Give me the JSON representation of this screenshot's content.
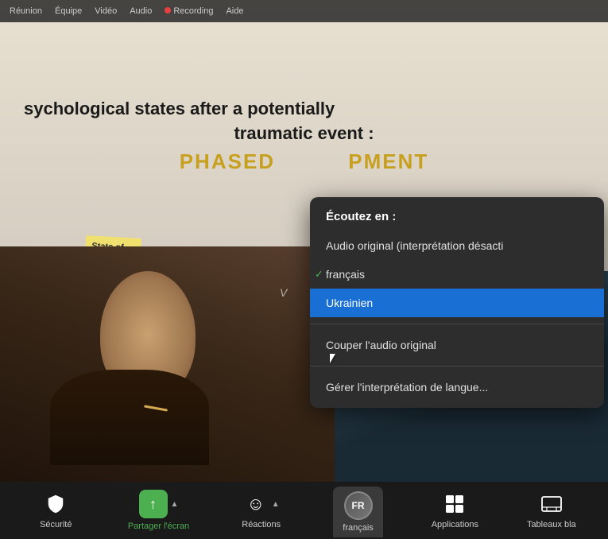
{
  "topbar": {
    "buttons": [
      "Réunion",
      "Équipe",
      "Vidéo",
      "Audio",
      "Recording",
      "Aide"
    ]
  },
  "slide": {
    "line1": "sychological states after a potentially",
    "line2": "traumatic event :",
    "line3": "PHASED         PMENT"
  },
  "dropdown": {
    "header": "Écoutez en :",
    "items": [
      {
        "id": "audio-original",
        "label": "Audio original (interprétation désacti",
        "checked": false,
        "selected": false
      },
      {
        "id": "francais",
        "label": "français",
        "checked": true,
        "selected": false
      },
      {
        "id": "ukrainien",
        "label": "Ukrainien",
        "checked": false,
        "selected": true
      },
      {
        "id": "couper-audio",
        "label": "Couper l'audio original",
        "checked": false,
        "selected": false
      },
      {
        "id": "gerer-interpretation",
        "label": "Gérer l'interprétation de langue...",
        "checked": false,
        "selected": false
      }
    ]
  },
  "toolbar": {
    "items": [
      {
        "id": "securite",
        "label": "Sécurité",
        "icon": "🛡️",
        "type": "normal"
      },
      {
        "id": "partager-ecran",
        "label": "Partager l'écran",
        "icon": "↑",
        "type": "share",
        "chevron": true
      },
      {
        "id": "reactions",
        "label": "Réactions",
        "icon": "☺",
        "type": "normal",
        "chevron": true
      },
      {
        "id": "francais",
        "label": "français",
        "icon": "FR",
        "type": "badge",
        "active_tab": true
      },
      {
        "id": "applications",
        "label": "Applications",
        "icon": "⊞",
        "type": "normal"
      },
      {
        "id": "tableaux",
        "label": "Tableaux bla",
        "icon": "▭",
        "type": "normal"
      }
    ]
  }
}
